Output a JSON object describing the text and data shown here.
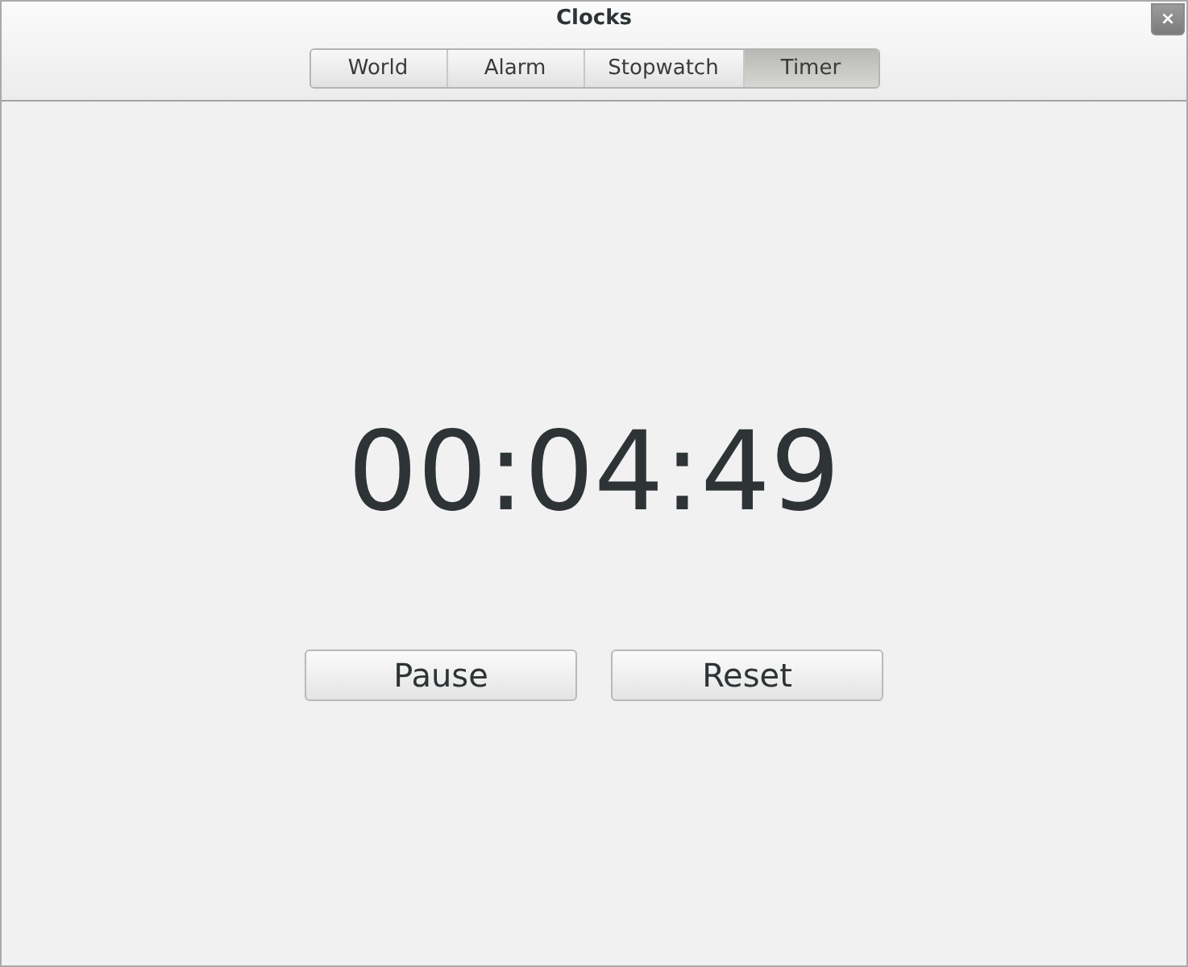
{
  "window": {
    "title": "Clocks",
    "close": "×"
  },
  "tabs": [
    {
      "label": "World",
      "selected": false
    },
    {
      "label": "Alarm",
      "selected": false
    },
    {
      "label": "Stopwatch",
      "selected": false
    },
    {
      "label": "Timer",
      "selected": true
    }
  ],
  "timer": {
    "time": "00:04:49"
  },
  "buttons": [
    "Pause",
    "Reset"
  ]
}
